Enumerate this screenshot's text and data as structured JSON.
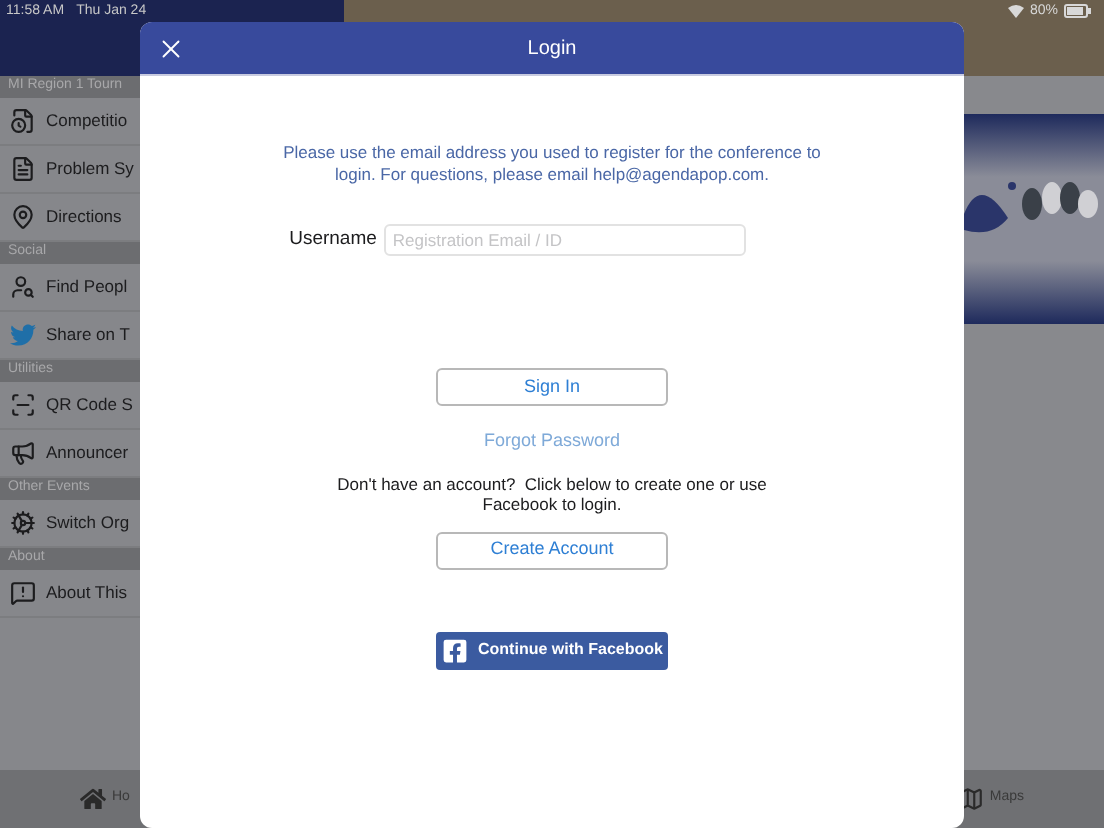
{
  "status_bar": {
    "time": "11:58 AM",
    "date": "Thu Jan 24",
    "battery": "80%"
  },
  "sidebar": {
    "sections": [
      {
        "title": "MI Region 1 Tourn",
        "items": [
          {
            "label": "Competitio",
            "kind": "schedule"
          },
          {
            "label": "Problem Sy",
            "kind": "document"
          },
          {
            "label": "Directions",
            "kind": "pin"
          }
        ]
      },
      {
        "title": "Social",
        "items": [
          {
            "label": "Find Peopl",
            "kind": "people"
          },
          {
            "label": "Share on T",
            "kind": "share"
          }
        ]
      },
      {
        "title": "Utilities",
        "items": [
          {
            "label": "QR Code S",
            "kind": "scan"
          },
          {
            "label": "Announcer",
            "kind": "announce"
          }
        ]
      },
      {
        "title": "Other Events",
        "items": [
          {
            "label": "Switch Org",
            "kind": "switch"
          }
        ]
      },
      {
        "title": "About",
        "items": [
          {
            "label": "About This",
            "kind": "about"
          }
        ]
      }
    ]
  },
  "tab_bar": [
    {
      "label": "Ho",
      "kind": "home"
    },
    {
      "label": "Maps",
      "kind": "maps"
    }
  ],
  "dialog": {
    "title": "Login",
    "message": "Please use the email address you used to register for the conference to login. For questions, please email help@agendapop.com.",
    "username": {
      "label": "Username",
      "placeholder": "Registration Email / ID"
    },
    "sign_in": "Sign In",
    "forgot_password": "Forgot Password",
    "signup_message": "Don't have an account?  Click below to create one or use Facebook to login.",
    "create_account": "Create Account",
    "facebook": "Continue with Facebook"
  }
}
